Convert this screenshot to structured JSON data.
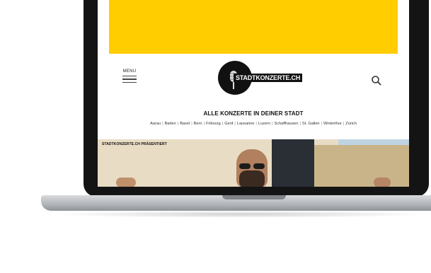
{
  "header": {
    "menu_label": "MENU",
    "logo_text": "STADTKONZERTE.CH",
    "search_icon": "search-icon"
  },
  "tagline": "ALLE KONZERTE IN DEINER STADT",
  "cities": [
    "Aarau",
    "Baden",
    "Basel",
    "Bern",
    "Fribourg",
    "Genf",
    "Lausanne",
    "Luzern",
    "Schaffhausen",
    "St. Gallen",
    "Winterthur",
    "Zürich"
  ],
  "hero": {
    "badge": "STADTKONZERTE.CH PRÄSENTIERT"
  },
  "colors": {
    "banner": "#ffcd00",
    "bezel": "#141414",
    "logo": "#111111"
  }
}
